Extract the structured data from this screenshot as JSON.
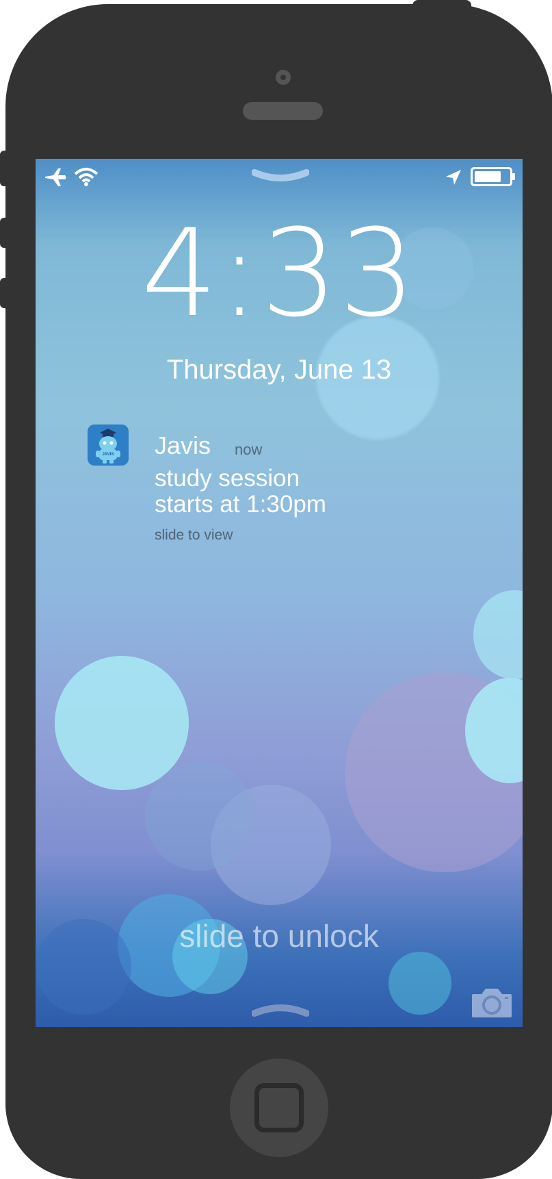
{
  "status_bar": {
    "left_icons": [
      "airplane-icon",
      "wifi-icon"
    ],
    "right_icons": [
      "location-arrow-icon",
      "battery-icon"
    ]
  },
  "lock_screen": {
    "time": "4:33",
    "date": "Thursday, June 13",
    "unlock_hint": "slide to unlock"
  },
  "notification": {
    "app_name": "Javis",
    "app_icon_label": "JAVIS",
    "timestamp": "now",
    "message_line1": "study session",
    "message_line2": "starts at 1:30pm",
    "action_hint": "slide to view"
  },
  "colors": {
    "device_body": "#333333",
    "app_icon_bg": "#2f7fc7"
  },
  "icons": {
    "camera": "camera-icon",
    "home_button": "home-button-icon"
  }
}
